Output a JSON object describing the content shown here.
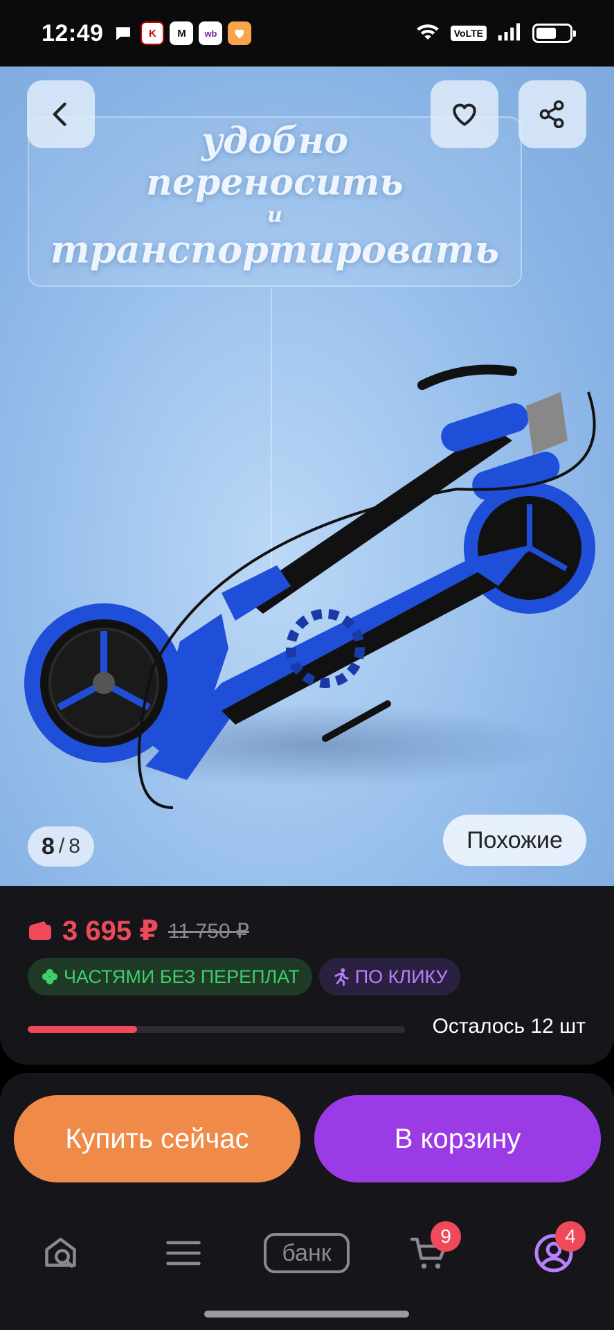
{
  "status_bar": {
    "time": "12:49",
    "notifications": [
      "chat-icon",
      "kp-app-icon",
      "magnit-app-icon",
      "wb-app-icon",
      "heart-app-icon"
    ],
    "notif_k": "K",
    "notif_m": "M",
    "notif_wb": "wb",
    "volte": "VoLTE",
    "battery_level": 0.6
  },
  "hero": {
    "tagline_line1": "удобно",
    "tagline_line2": "переносить",
    "tagline_line3": "и",
    "tagline_line4": "транспортировать",
    "counter_current": "8",
    "counter_sep": "/",
    "counter_total": "8",
    "similar_label": "Похожие"
  },
  "price": {
    "current": "3 695 ₽",
    "old": "11 750 ₽",
    "accent_color": "#f04a5a"
  },
  "badges": {
    "installments": "ЧАСТЯМИ БЕЗ ПЕРЕПЛАТ",
    "one_click": "ПО КЛИКУ"
  },
  "stock": {
    "text": "Осталось 12 шт",
    "fill_fraction": 0.29
  },
  "actions": {
    "buy_now": "Купить сейчас",
    "add_to_cart": "В корзину"
  },
  "nav": {
    "bank_label": "банк",
    "cart_badge": "9",
    "profile_badge": "4"
  }
}
